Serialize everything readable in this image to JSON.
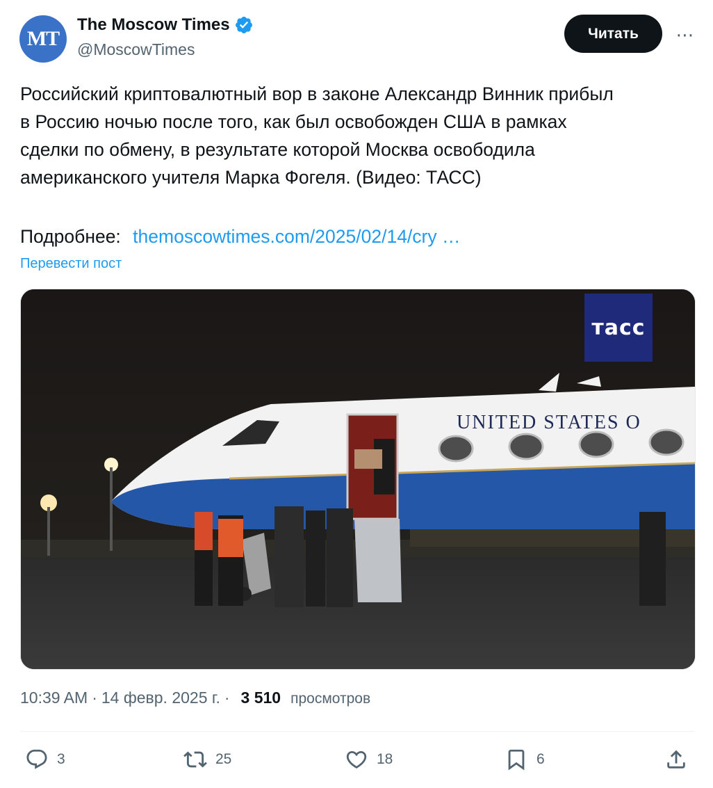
{
  "author": {
    "avatar_text": "MT",
    "display_name": "The Moscow Times",
    "handle": "@MoscowTimes",
    "verified_icon": "verified-badge-icon"
  },
  "header": {
    "follow_label": "Читать",
    "more_label": "⋯"
  },
  "tweet": {
    "text": "Российский криптовалютный вор в законе Александр Винник прибыл\nв Россию ночью после того, как был освобожден США в рамках\nсделки по обмену, в результате которой Москва освободила\nамериканского учителя Марка Фогеля. (Видео: ТАСС)",
    "more_prefix": "Подробнее:",
    "link_text": "themoscowtimes.com/2025/02/14/cry …",
    "translate_label": "Перевести пост"
  },
  "media": {
    "watermark": "тасс",
    "plane_text": "UNITED STATES O"
  },
  "meta": {
    "time": "10:39 AM",
    "sep1": "·",
    "date": "14 февр. 2025 г.",
    "sep2": "·",
    "views_count": "3 510",
    "views_label": "просмотров"
  },
  "actions": {
    "replies": "3",
    "reposts": "25",
    "likes": "18",
    "bookmarks": "6"
  },
  "colors": {
    "link": "#1d9bf0",
    "text": "#0f1419",
    "muted": "#536471",
    "avatar_bg": "#3a72c7",
    "tass_bg": "#1f2a7a"
  }
}
